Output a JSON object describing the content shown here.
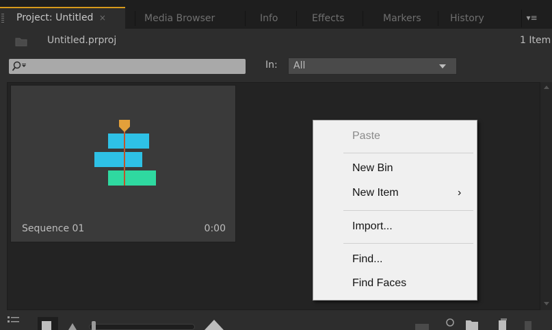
{
  "tabs": [
    {
      "label": "Project: Untitled",
      "close": "×",
      "active": true
    },
    {
      "label": "Media Browser"
    },
    {
      "label": "Info"
    },
    {
      "label": "Effects"
    },
    {
      "label": "Markers"
    },
    {
      "label": "History"
    }
  ],
  "tab_menu_glyph": "▾≡",
  "project": {
    "name": "Untitled.prproj",
    "item_count": "1 Item",
    "folder_icon": "folder-icon"
  },
  "search": {
    "value": "",
    "icon": "search-icon"
  },
  "filter": {
    "label": "In:",
    "value": "All"
  },
  "sequence": {
    "name": "Sequence 01",
    "duration": "0:00",
    "icon": "sequence-icon"
  },
  "context_menu": {
    "paste": "Paste",
    "new_bin": "New Bin",
    "new_item": "New Item",
    "new_item_arrow": "›",
    "import": "Import...",
    "find": "Find...",
    "find_faces": "Find Faces"
  },
  "colors": {
    "accent": "#d89a1c",
    "sequence_orange": "#e3a03a",
    "sequence_blue": "#2ec1e6",
    "sequence_green": "#2fd9a0",
    "playhead": "#c0542a"
  },
  "toolbar_icons": [
    "list-view-icon",
    "icon-view-icon",
    "zoom-small-icon",
    "zoom-slider",
    "zoom-large-icon",
    "automate-icon",
    "find-icon",
    "new-bin-icon",
    "new-item-icon",
    "clear-icon"
  ]
}
